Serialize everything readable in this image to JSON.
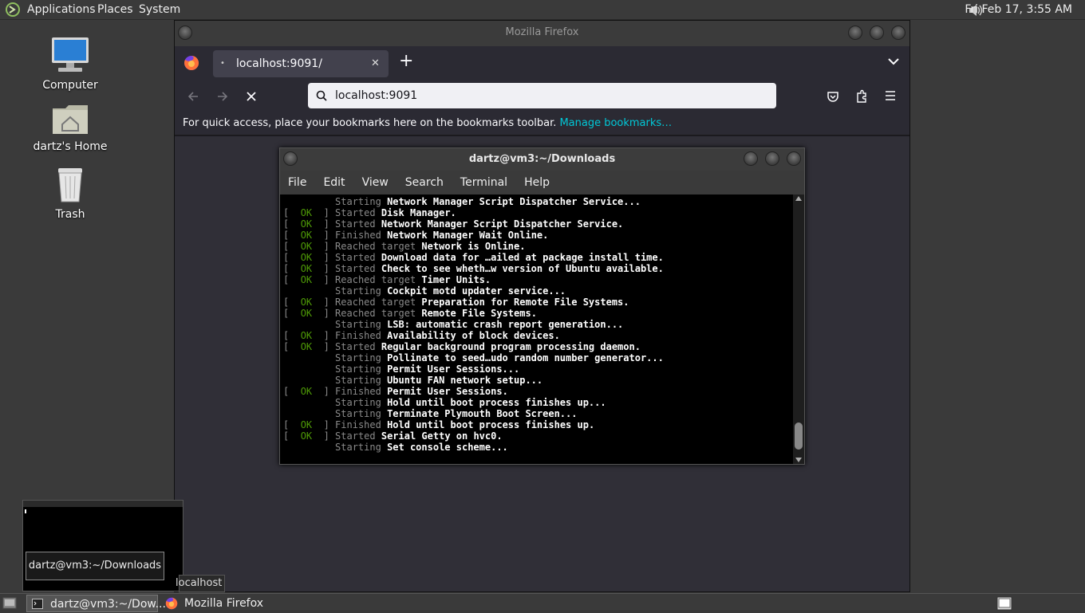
{
  "topbar": {
    "menus": [
      "Applications",
      "Places",
      "System"
    ],
    "clock": "Fri Feb 17,  3:55 AM",
    "logo_icon": "mate-logo-icon",
    "volume_icon": "speaker-icon"
  },
  "desktop": {
    "icons": [
      {
        "label": "Computer",
        "icon": "computer-icon"
      },
      {
        "label": "dartz's Home",
        "icon": "home-folder-icon"
      },
      {
        "label": "Trash",
        "icon": "trash-icon"
      }
    ]
  },
  "firefox": {
    "title": "Mozilla Firefox",
    "tab": {
      "label": "localhost:9091/"
    },
    "url": "localhost:9091",
    "bookmarks_msg": "For quick access, place your bookmarks here on the bookmarks toolbar.",
    "bookmarks_link": "Manage bookmarks…"
  },
  "terminal": {
    "title": "dartz@vm3:~/Downloads",
    "menu": [
      "File",
      "Edit",
      "View",
      "Search",
      "Terminal",
      "Help"
    ],
    "lines": [
      {
        "ok": false,
        "verb": "Starting",
        "rest": "Network Manager Script Dispatcher Service..."
      },
      {
        "ok": true,
        "verb": "Started",
        "rest": "Disk Manager."
      },
      {
        "ok": true,
        "verb": "Started",
        "rest": "Network Manager Script Dispatcher Service."
      },
      {
        "ok": true,
        "verb": "Finished",
        "rest": "Network Manager Wait Online."
      },
      {
        "ok": true,
        "verb": "Reached target",
        "rest": "Network is Online."
      },
      {
        "ok": true,
        "verb": "Started",
        "rest": "Download data for …ailed at package install time."
      },
      {
        "ok": true,
        "verb": "Started",
        "rest": "Check to see wheth…w version of Ubuntu available."
      },
      {
        "ok": true,
        "verb": "Reached target",
        "rest": "Timer Units."
      },
      {
        "ok": false,
        "verb": "Starting",
        "rest": "Cockpit motd updater service..."
      },
      {
        "ok": true,
        "verb": "Reached target",
        "rest": "Preparation for Remote File Systems."
      },
      {
        "ok": true,
        "verb": "Reached target",
        "rest": "Remote File Systems."
      },
      {
        "ok": false,
        "verb": "Starting",
        "rest": "LSB: automatic crash report generation..."
      },
      {
        "ok": true,
        "verb": "Finished",
        "rest": "Availability of block devices."
      },
      {
        "ok": true,
        "verb": "Started",
        "rest": "Regular background program processing daemon."
      },
      {
        "ok": false,
        "verb": "Starting",
        "rest": "Pollinate to seed…udo random number generator..."
      },
      {
        "ok": false,
        "verb": "Starting",
        "rest": "Permit User Sessions..."
      },
      {
        "ok": false,
        "verb": "Starting",
        "rest": "Ubuntu FAN network setup..."
      },
      {
        "ok": true,
        "verb": "Finished",
        "rest": "Permit User Sessions."
      },
      {
        "ok": false,
        "verb": "Starting",
        "rest": "Hold until boot process finishes up..."
      },
      {
        "ok": false,
        "verb": "Starting",
        "rest": "Terminate Plymouth Boot Screen..."
      },
      {
        "ok": true,
        "verb": "Finished",
        "rest": "Hold until boot process finishes up."
      },
      {
        "ok": true,
        "verb": "Started",
        "rest": "Serial Getty on hvc0."
      },
      {
        "ok": false,
        "verb": "Starting",
        "rest": "Set console scheme..."
      }
    ]
  },
  "preview": {
    "tooltip": "dartz@vm3:~/Downloads",
    "partial_label": "localhost"
  },
  "taskbar": {
    "items": [
      {
        "label": "dartz@vm3:~/Dow...",
        "icon": "terminal-icon"
      },
      {
        "label": "Mozilla Firefox",
        "icon": "firefox-icon"
      }
    ]
  }
}
